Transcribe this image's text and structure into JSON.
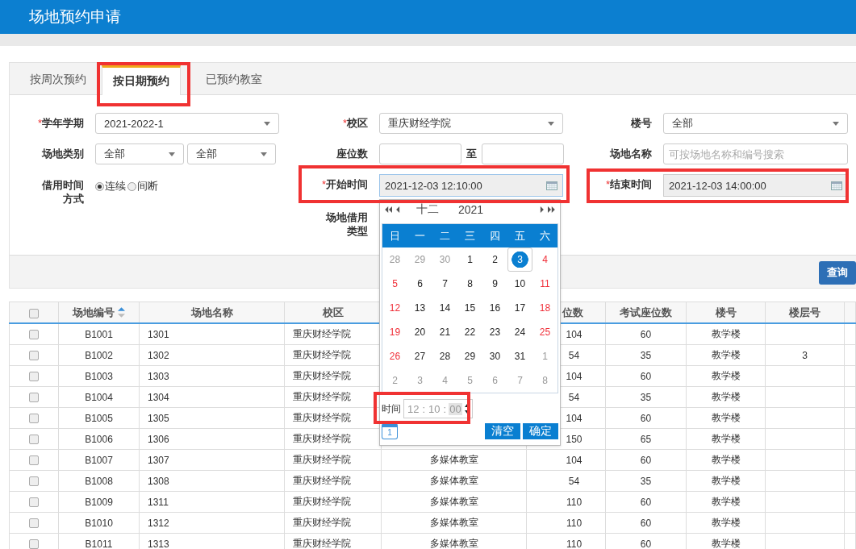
{
  "header": {
    "title": "场地预约申请"
  },
  "tabs": [
    {
      "label": "按周次预约",
      "selected": false
    },
    {
      "label": "按日期预约",
      "selected": true
    },
    {
      "label": "已预约教室",
      "selected": false
    }
  ],
  "form": {
    "term": {
      "mark": "*",
      "label": "学年学期",
      "value": "2021-2022-1"
    },
    "campus": {
      "mark": "*",
      "label": "校区",
      "value": "重庆财经学院"
    },
    "building": {
      "label": "楼号",
      "value": "全部"
    },
    "category": {
      "label": "场地类别",
      "values": [
        "全部",
        "全部"
      ]
    },
    "seats": {
      "label": "座位数",
      "to": "至"
    },
    "name": {
      "label": "场地名称",
      "placeholder": "可按场地名称和编号搜索"
    },
    "mode": {
      "label": "借用时间方式",
      "options": [
        {
          "label": "连续",
          "selected": true
        },
        {
          "label": "间断",
          "selected": false
        }
      ]
    },
    "start": {
      "mark": "*",
      "label": "开始时间",
      "value": "2021-12-03 12:10:00"
    },
    "end": {
      "mark": "*",
      "label": "结束时间",
      "value": "2021-12-03 14:00:00"
    },
    "usage": {
      "label": "场地借用类型"
    },
    "query": "查询"
  },
  "calendar": {
    "month": "十二",
    "year": "2021",
    "weekdays": [
      "日",
      "一",
      "二",
      "三",
      "四",
      "五",
      "六"
    ],
    "days": [
      {
        "label": "28",
        "muted": true,
        "selected": false
      },
      {
        "label": "29",
        "muted": true,
        "selected": false
      },
      {
        "label": "30",
        "muted": true,
        "selected": false
      },
      {
        "label": "1",
        "muted": false,
        "selected": false
      },
      {
        "label": "2",
        "muted": false,
        "selected": false
      },
      {
        "label": "3",
        "muted": false,
        "selected": true
      },
      {
        "label": "4",
        "muted": false,
        "selected": false
      },
      {
        "label": "5",
        "muted": false,
        "selected": false
      },
      {
        "label": "6",
        "muted": false,
        "selected": false
      },
      {
        "label": "7",
        "muted": false,
        "selected": false
      },
      {
        "label": "8",
        "muted": false,
        "selected": false
      },
      {
        "label": "9",
        "muted": false,
        "selected": false
      },
      {
        "label": "10",
        "muted": false,
        "selected": false
      },
      {
        "label": "11",
        "muted": false,
        "selected": false
      },
      {
        "label": "12",
        "muted": false,
        "selected": false
      },
      {
        "label": "13",
        "muted": false,
        "selected": false
      },
      {
        "label": "14",
        "muted": false,
        "selected": false
      },
      {
        "label": "15",
        "muted": false,
        "selected": false
      },
      {
        "label": "16",
        "muted": false,
        "selected": false
      },
      {
        "label": "17",
        "muted": false,
        "selected": false
      },
      {
        "label": "18",
        "muted": false,
        "selected": false
      },
      {
        "label": "19",
        "muted": false,
        "selected": false
      },
      {
        "label": "20",
        "muted": false,
        "selected": false
      },
      {
        "label": "21",
        "muted": false,
        "selected": false
      },
      {
        "label": "22",
        "muted": false,
        "selected": false
      },
      {
        "label": "23",
        "muted": false,
        "selected": false
      },
      {
        "label": "24",
        "muted": false,
        "selected": false
      },
      {
        "label": "25",
        "muted": false,
        "selected": false
      },
      {
        "label": "26",
        "muted": false,
        "selected": false
      },
      {
        "label": "27",
        "muted": false,
        "selected": false
      },
      {
        "label": "28",
        "muted": false,
        "selected": false
      },
      {
        "label": "29",
        "muted": false,
        "selected": false
      },
      {
        "label": "30",
        "muted": false,
        "selected": false
      },
      {
        "label": "31",
        "muted": false,
        "selected": false
      },
      {
        "label": "1",
        "muted": true,
        "selected": false
      },
      {
        "label": "2",
        "muted": true,
        "selected": false
      },
      {
        "label": "3",
        "muted": true,
        "selected": false
      },
      {
        "label": "4",
        "muted": true,
        "selected": false
      },
      {
        "label": "5",
        "muted": true,
        "selected": false
      },
      {
        "label": "6",
        "muted": true,
        "selected": false
      },
      {
        "label": "7",
        "muted": true,
        "selected": false
      },
      {
        "label": "8",
        "muted": true,
        "selected": false
      }
    ],
    "time_label": "时间",
    "time_parts": [
      {
        "kind": "num",
        "text": "12",
        "selected": false
      },
      {
        "kind": "sep",
        "text": ":"
      },
      {
        "kind": "num",
        "text": "10",
        "selected": false
      },
      {
        "kind": "sep",
        "text": ":"
      },
      {
        "kind": "num",
        "text": "00",
        "selected": true
      }
    ],
    "today": "1",
    "clear": "清空",
    "ok": "确定"
  },
  "table": {
    "header_checked": false,
    "columns": [
      {
        "label": "场地编号",
        "sortable": true
      },
      {
        "label": "场地名称"
      },
      {
        "label": "校区"
      },
      null,
      {
        "label": "位数"
      },
      {
        "label": "考试座位数"
      },
      {
        "label": "楼号"
      },
      {
        "label": "楼层号"
      }
    ],
    "rows": [
      {
        "checked": false,
        "cells": [
          "B1001",
          "1301",
          "重庆财经学院",
          null,
          "104",
          "60",
          "教学楼",
          null
        ]
      },
      {
        "checked": false,
        "cells": [
          "B1002",
          "1302",
          "重庆财经学院",
          null,
          "54",
          "35",
          "教学楼",
          "3"
        ]
      },
      {
        "checked": false,
        "cells": [
          "B1003",
          "1303",
          "重庆财经学院",
          null,
          "104",
          "60",
          "教学楼",
          null
        ]
      },
      {
        "checked": false,
        "cells": [
          "B1004",
          "1304",
          "重庆财经学院",
          null,
          "54",
          "35",
          "教学楼",
          null
        ]
      },
      {
        "checked": false,
        "cells": [
          "B1005",
          "1305",
          "重庆财经学院",
          null,
          "104",
          "60",
          "教学楼",
          null
        ]
      },
      {
        "checked": false,
        "cells": [
          "B1006",
          "1306",
          "重庆财经学院",
          null,
          "150",
          "65",
          "教学楼",
          null
        ]
      },
      {
        "checked": false,
        "cells": [
          "B1007",
          "1307",
          "重庆财经学院",
          "多媒体教室",
          "104",
          "60",
          "教学楼",
          null
        ]
      },
      {
        "checked": false,
        "cells": [
          "B1008",
          "1308",
          "重庆财经学院",
          "多媒体教室",
          "54",
          "35",
          "教学楼",
          null
        ]
      },
      {
        "checked": false,
        "cells": [
          "B1009",
          "1311",
          "重庆财经学院",
          "多媒体教室",
          "110",
          "60",
          "教学楼",
          null
        ]
      },
      {
        "checked": false,
        "cells": [
          "B1010",
          "1312",
          "重庆财经学院",
          "多媒体教室",
          "110",
          "60",
          "教学楼",
          null
        ]
      },
      {
        "checked": false,
        "cells": [
          "B1011",
          "1313",
          "重庆财经学院",
          "多媒体教室",
          "110",
          "60",
          "教学楼",
          null
        ]
      }
    ]
  }
}
